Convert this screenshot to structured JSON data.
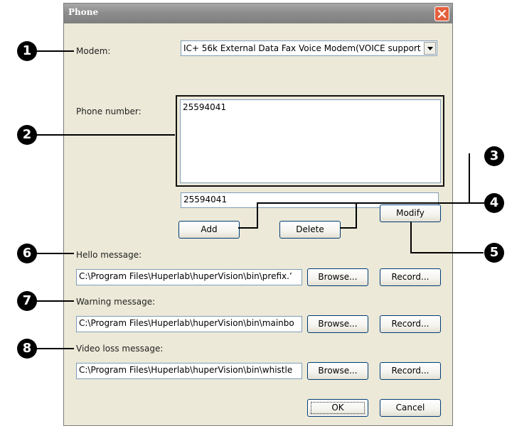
{
  "window": {
    "title": "Phone"
  },
  "modem": {
    "label": "Modem:",
    "selected": "IC+ 56k External Data Fax Voice Modem(VOICE support"
  },
  "phone": {
    "label": "Phone number:",
    "list_items": [
      "25594041"
    ],
    "input_value": "25594041",
    "add_label": "Add",
    "delete_label": "Delete",
    "modify_label": "Modify"
  },
  "hello": {
    "label": "Hello message:",
    "path": "C:\\Program Files\\Huperlab\\huperVision\\bin\\prefix.’"
  },
  "warning": {
    "label": "Warning message:",
    "path": "C:\\Program Files\\Huperlab\\huperVision\\bin\\mainbo"
  },
  "videoloss": {
    "label": "Video loss message:",
    "path": "C:\\Program Files\\Huperlab\\huperVision\\bin\\whistle"
  },
  "buttons": {
    "browse": "Browse...",
    "record": "Record...",
    "ok": "OK",
    "cancel": "Cancel"
  },
  "callouts": [
    "1",
    "2",
    "3",
    "4",
    "5",
    "6",
    "7",
    "8"
  ],
  "colors": {
    "titlebar": "#8d8d8d",
    "dialog_bg": "#ece9d8",
    "close_button": "#e5603e",
    "button_border": "#003c74"
  }
}
